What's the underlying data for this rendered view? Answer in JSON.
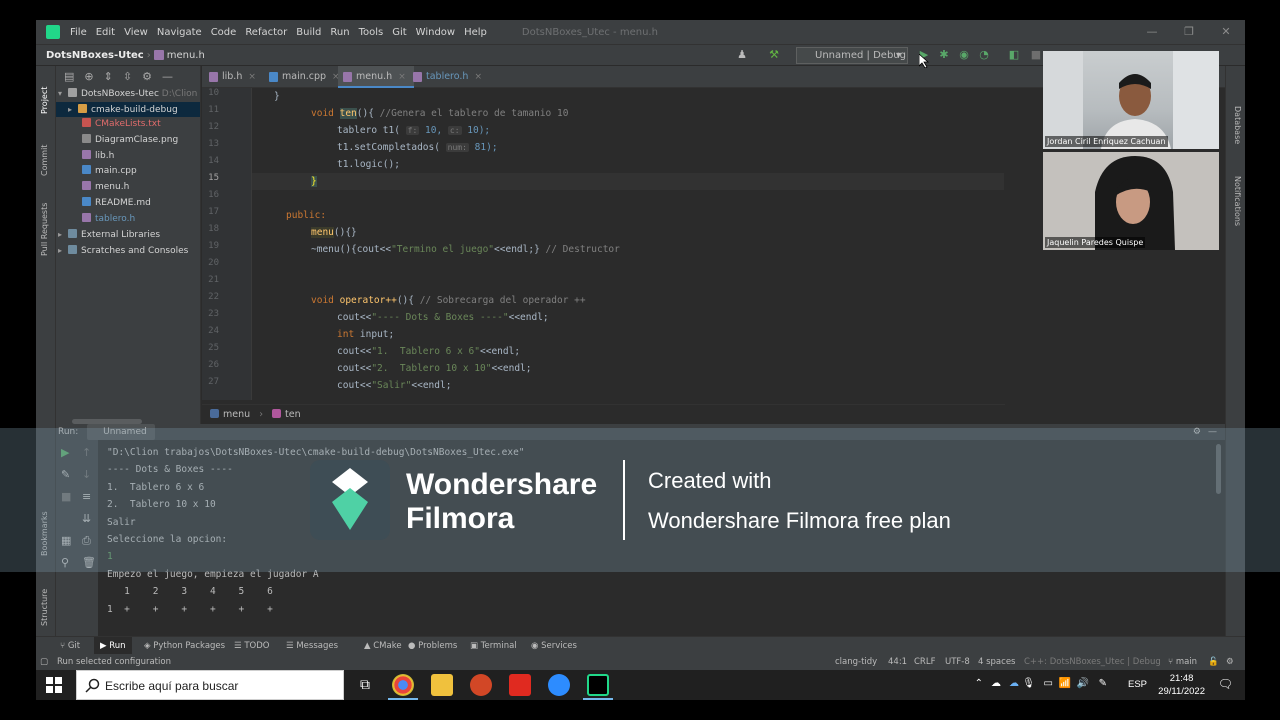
{
  "menu": [
    "File",
    "Edit",
    "View",
    "Navigate",
    "Code",
    "Refactor",
    "Build",
    "Run",
    "Tools",
    "Git",
    "Window",
    "Help"
  ],
  "window_title": "DotsNBoxes_Utec - menu.h",
  "nav": {
    "project": "DotsNBoxes-Utec",
    "file": "menu.h"
  },
  "run_config": "Unnamed | Debug",
  "tabs": [
    "lib.h",
    "main.cpp",
    "menu.h",
    "tablero.h"
  ],
  "left_stripe": [
    "Project",
    "Commit",
    "Pull Requests",
    "Bookmarks",
    "Structure"
  ],
  "right_stripe": [
    "Database",
    "Notifications"
  ],
  "project_tree": {
    "root": "DotsNBoxes-Utec",
    "root_path": "D:\\Clion",
    "items": [
      "cmake-build-debug",
      "CMakeLists.txt",
      "DiagramClase.png",
      "lib.h",
      "main.cpp",
      "menu.h",
      "README.md",
      "tablero.h"
    ],
    "external": "External Libraries",
    "scratches": "Scratches and Consoles"
  },
  "gutter": [
    "10",
    "11",
    "12",
    "13",
    "14",
    "15",
    "16",
    "17",
    "18",
    "19",
    "20",
    "21",
    "22",
    "23",
    "24",
    "25",
    "26",
    "27"
  ],
  "code": {
    "l10": "}",
    "l11a": "void ",
    "l11b": "ten",
    "l11c": "(){ ",
    "l11d": "//Genera el tablero de tamanio 10",
    "l12a": "tablero t1( ",
    "l12h1": "f:",
    "l12b": " 10, ",
    "l12h2": "c:",
    "l12c": " 10);",
    "l13a": "t1.setCompletados( ",
    "l13h": "num:",
    "l13b": " 81);",
    "l14": "t1.logic();",
    "l15": "}",
    "l17": "public:",
    "l18a": "menu",
    "l18b": "(){}",
    "l19a": "~menu(){cout<<",
    "l19b": "\"Termino el juego\"",
    "l19c": "<<endl;} ",
    "l19d": "// Destructor",
    "l22a": "void ",
    "l22b": "operator++",
    "l22c": "(){ ",
    "l22d": "// Sobrecarga del operador ++",
    "l23a": "cout<<",
    "l23b": "\"---- Dots & Boxes ----\"",
    "l23c": "<<endl;",
    "l24a": "int ",
    "l24b": "input;",
    "l25a": "cout<<",
    "l25b": "\"1.  Tablero 6 x 6\"",
    "l25c": "<<endl;",
    "l26a": "cout<<",
    "l26b": "\"2.  Tablero 10 x 10\"",
    "l26c": "<<endl;",
    "l27a": "cout<<",
    "l27b": "\"Salir\"",
    "l27c": "<<endl;"
  },
  "code_breadcrumbs": [
    "menu",
    "ten"
  ],
  "run": {
    "label": "Run:",
    "tab": "Unnamed",
    "output": [
      "\"D:\\Clion trabajos\\DotsNBoxes-Utec\\cmake-build-debug\\DotsNBoxes_Utec.exe\"",
      "---- Dots & Boxes ----",
      "1.  Tablero 6 x 6",
      "2.  Tablero 10 x 10",
      "Salir",
      "Seleccione la opcion:",
      "1",
      "Empezo el juego, empieza el jugador A",
      "   1    2    3    4    5    6",
      "1  +    +    +    +    +    +"
    ]
  },
  "bottom_tools": [
    "Git",
    "Run",
    "Python Packages",
    "TODO",
    "Messages",
    "CMake",
    "Problems",
    "Terminal",
    "Services"
  ],
  "status": {
    "left": "Run selected configuration",
    "clang": "clang-tidy",
    "pos": "44:1",
    "crlf": "CRLF",
    "enc": "UTF-8",
    "indent": "4 spaces",
    "context": "C++: DotsNBoxes_Utec | Debug",
    "branch": "main"
  },
  "participants": [
    "Jordan Ciril Enriquez Cachuan",
    "Jaquelin Paredes Quispe"
  ],
  "watermark": {
    "brand_1": "Wondershare",
    "brand_2": "Filmora",
    "created": "Created with",
    "plan": "Wondershare Filmora free plan"
  },
  "taskbar": {
    "search": "Escribe aquí para buscar",
    "lang": "ESP",
    "time": "21:48",
    "date": "29/11/2022"
  }
}
